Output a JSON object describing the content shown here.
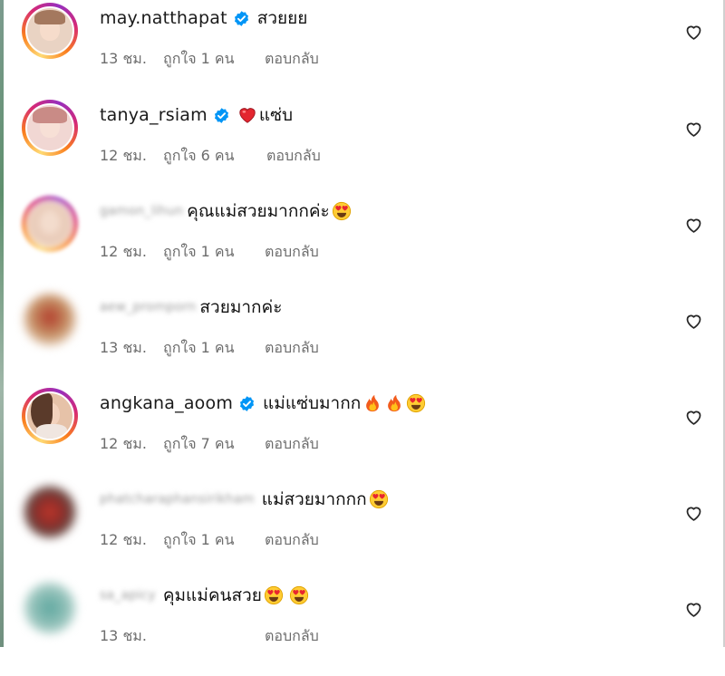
{
  "comments": [
    {
      "username": "may.natthapat",
      "username_blurred": false,
      "verified": true,
      "text": "สวยยย",
      "emojis": [],
      "time": "13 ชม.",
      "likes": "ถูกใจ 1 คน",
      "reply": "ตอบกลับ",
      "avatar_ring": true,
      "avatar_color": "#e9d3c3"
    },
    {
      "username": "tanya_rsiam",
      "username_blurred": false,
      "verified": true,
      "text": "แซ่บ",
      "emojis_before": [
        "red-heart"
      ],
      "emojis": [],
      "time": "12 ชม.",
      "likes": "ถูกใจ 6 คน",
      "reply": "ตอบกลับ",
      "avatar_ring": true,
      "avatar_color": "#f1d7d3"
    },
    {
      "username": "gamon_lihun",
      "username_blurred": true,
      "verified": false,
      "text": "คุณแม่สวยมากกค่ะ",
      "emojis": [
        "heart-eyes"
      ],
      "time": "12 ชม.",
      "likes": "ถูกใจ 1 คน",
      "reply": "ตอบกลับ",
      "avatar_ring": true,
      "avatar_color": "#eacdbb"
    },
    {
      "username": "aew_promporn",
      "username_blurred": true,
      "verified": false,
      "text": "สวยมากค่ะ",
      "emojis": [],
      "time": "13 ชม.",
      "likes": "ถูกใจ 1 คน",
      "reply": "ตอบกลับ",
      "avatar_ring": false,
      "avatar_color": "#c48e63"
    },
    {
      "username": "angkana_aoom",
      "username_blurred": false,
      "verified": true,
      "text": "แม่แซ่บมากก",
      "emojis": [
        "fire",
        "fire",
        "heart-eyes"
      ],
      "time": "12 ชม.",
      "likes": "ถูกใจ 7 คน",
      "reply": "ตอบกลับ",
      "avatar_ring": true,
      "avatar_color": "#e6c2a8"
    },
    {
      "username": "phatcharaphansirikham",
      "username_blurred": true,
      "verified": false,
      "text": "แม่สวยมากกก",
      "emojis": [
        "heart-eyes"
      ],
      "time": "12 ชม.",
      "likes": "ถูกใจ 1 คน",
      "reply": "ตอบกลับ",
      "avatar_ring": false,
      "avatar_color": "#a33a36"
    },
    {
      "username": "sa_apicy",
      "username_blurred": true,
      "verified": false,
      "text": "คุมแม่คนสวย",
      "emojis": [
        "heart-eyes",
        "heart-eyes"
      ],
      "time": "13 ชม.",
      "likes": "",
      "reply": "ตอบกลับ",
      "avatar_ring": false,
      "avatar_color": "#8fbfb7"
    }
  ],
  "icons": {
    "verified": "verified-badge-icon",
    "like": "heart-outline-icon",
    "emoji_heart_eyes": "heart-eyes-emoji",
    "emoji_fire": "fire-emoji",
    "emoji_red_heart": "red-heart-emoji"
  },
  "colors": {
    "verified_blue": "#0095f6",
    "meta_gray": "#6d6d6d",
    "story_ring": "#d62976"
  }
}
